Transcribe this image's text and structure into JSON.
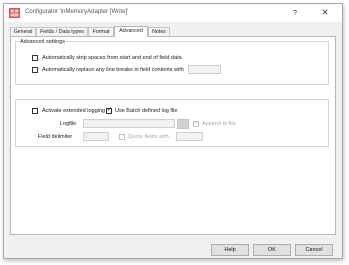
{
  "window": {
    "title": "Configurator 'inMemoryAdapter [Write]'",
    "help_glyph": "?",
    "close_glyph": "✕"
  },
  "tabs": [
    {
      "label": "General",
      "active": false
    },
    {
      "label": "Fields / Data types",
      "active": false
    },
    {
      "label": "Format",
      "active": false
    },
    {
      "label": "Advanced",
      "active": true
    },
    {
      "label": "Notes",
      "active": false
    }
  ],
  "advanced_settings": {
    "title": "Advanced settings",
    "strip_spaces_label": "Automatically strip spaces from start and end of field data",
    "strip_spaces_checked": false,
    "replace_line_breaks_label": "Automatically replace any line breaks in field contents with",
    "replace_line_breaks_checked": false,
    "replace_value": ""
  },
  "logging": {
    "extended_logging_label": "Activate extended logging",
    "extended_logging_checked": false,
    "batch_log_label": "Use Batch defined log file",
    "batch_log_checked": true,
    "logfile_label": "Logfile",
    "logfile_value": "",
    "append_label": "Append to file",
    "append_checked": true,
    "field_delimiter_label": "Field delimiter",
    "field_delimiter_value": ";",
    "quote_fields_label": "Quote fields with",
    "quote_fields_checked": false,
    "quote_value": ""
  },
  "buttons": {
    "help": "Help",
    "ok": "OK",
    "cancel": "Cancel"
  },
  "colors": {
    "accent": "#c0392b",
    "window_bg": "#f0f0f0"
  }
}
